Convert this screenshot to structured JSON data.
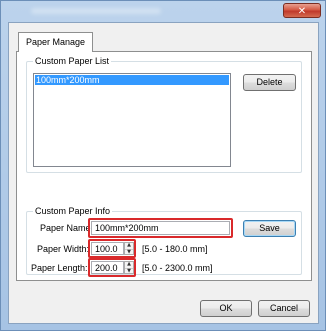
{
  "window": {
    "close_icon": "x-icon",
    "close_glyph": "✕"
  },
  "tab": {
    "label": "Paper Manage"
  },
  "custom_list": {
    "title": "Custom Paper List",
    "items": [
      "100mm*200mm"
    ],
    "delete_label": "Delete"
  },
  "custom_info": {
    "title": "Custom Paper Info",
    "name_label": "Paper Name:",
    "name_value": "100mm*200mm",
    "save_label": "Save",
    "width_label": "Paper Width:",
    "width_value": "100.0",
    "width_range": "[5.0 - 180.0 mm]",
    "length_label": "Paper Length:",
    "length_value": "200.0",
    "length_range": "[5.0 - 2300.0 mm]"
  },
  "footer": {
    "ok_label": "OK",
    "cancel_label": "Cancel"
  },
  "colors": {
    "highlight": "#d9292b",
    "selection": "#3399ff",
    "close": "#c0392b"
  }
}
